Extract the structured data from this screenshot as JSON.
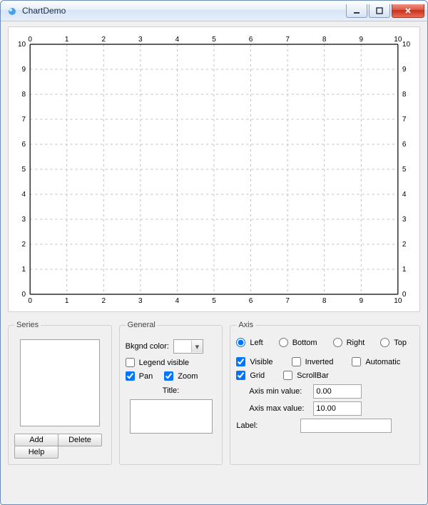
{
  "window": {
    "title": "ChartDemo"
  },
  "chart_data": {
    "type": "scatter",
    "series": [],
    "x_ticks": [
      0,
      1,
      2,
      3,
      4,
      5,
      6,
      7,
      8,
      9,
      10
    ],
    "y_ticks_left": [
      0,
      1,
      2,
      3,
      4,
      5,
      6,
      7,
      8,
      9,
      10
    ],
    "y_ticks_right": [
      0,
      1,
      2,
      3,
      4,
      5,
      6,
      7,
      8,
      9,
      10
    ],
    "x_top_ticks": [
      0,
      1,
      2,
      3,
      4,
      5,
      6,
      7,
      8,
      9,
      10
    ],
    "xlim": [
      0,
      10
    ],
    "ylim": [
      0,
      10
    ],
    "grid": true
  },
  "series": {
    "legend": "Series",
    "items": [],
    "add_label": "Add",
    "delete_label": "Delete",
    "help_label": "Help"
  },
  "general": {
    "legend": "General",
    "bkgnd_label": "Bkgnd color:",
    "bkgnd_color": "#ffffff",
    "legend_visible_label": "Legend visible",
    "legend_visible": false,
    "pan_label": "Pan",
    "pan": true,
    "zoom_label": "Zoom",
    "zoom": true,
    "title_label": "Title:",
    "title_value": ""
  },
  "axis": {
    "legend": "Axis",
    "options": {
      "left": "Left",
      "bottom": "Bottom",
      "right": "Right",
      "top": "Top",
      "selected": "left"
    },
    "visible_label": "Visible",
    "visible": true,
    "inverted_label": "Inverted",
    "inverted": false,
    "automatic_label": "Automatic",
    "automatic": false,
    "grid_label": "Grid",
    "grid": true,
    "scrollbar_label": "ScrollBar",
    "scrollbar": false,
    "min_label": "Axis min value:",
    "min_value": "0.00",
    "max_label": "Axis max value:",
    "max_value": "10.00",
    "label_label": "Label:",
    "label_value": ""
  }
}
